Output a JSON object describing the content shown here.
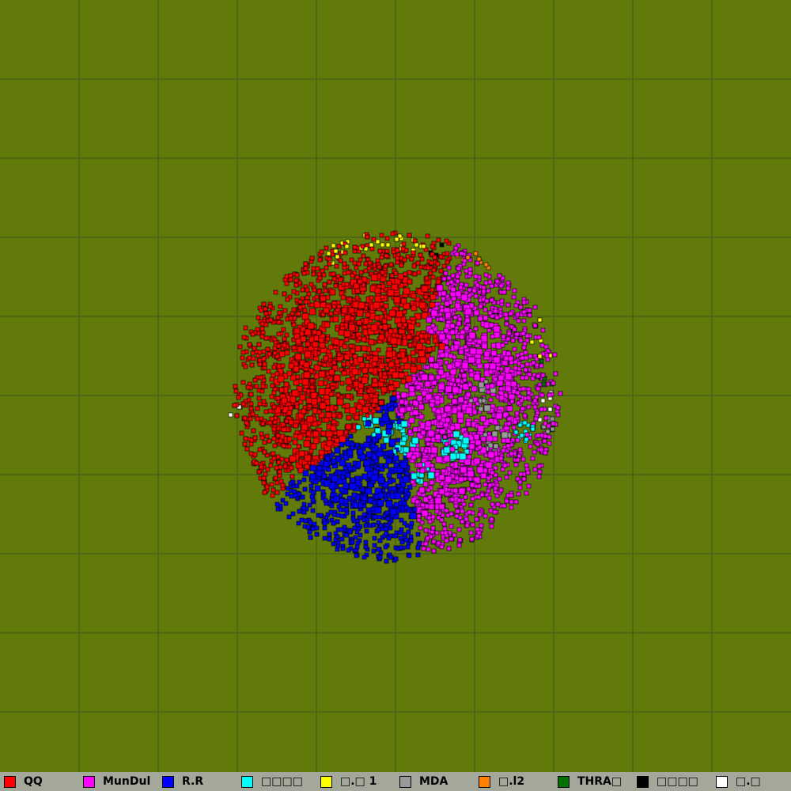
{
  "board": {
    "background": "#617a0a",
    "grid_color": "#3c5a1e",
    "cell_border": "#000000"
  },
  "legend": {
    "background": "#a4a89b",
    "teams": [
      {
        "name": "QQ",
        "color": "#ff0000"
      },
      {
        "name": "MunDul",
        "color": "#ff00ff"
      },
      {
        "name": "R.R",
        "color": "#0000ff"
      },
      {
        "name": "□□□□",
        "color": "#00ffff"
      },
      {
        "name": "□.□ 1",
        "color": "#ffff00"
      },
      {
        "name": "MDA",
        "color": "#999999"
      },
      {
        "name": "□.l2",
        "color": "#ff8000"
      },
      {
        "name": "THRA□",
        "color": "#007000"
      },
      {
        "name": "□□□□",
        "color": "#000000"
      },
      {
        "name": "□.□",
        "color": "#ffffff"
      }
    ]
  }
}
